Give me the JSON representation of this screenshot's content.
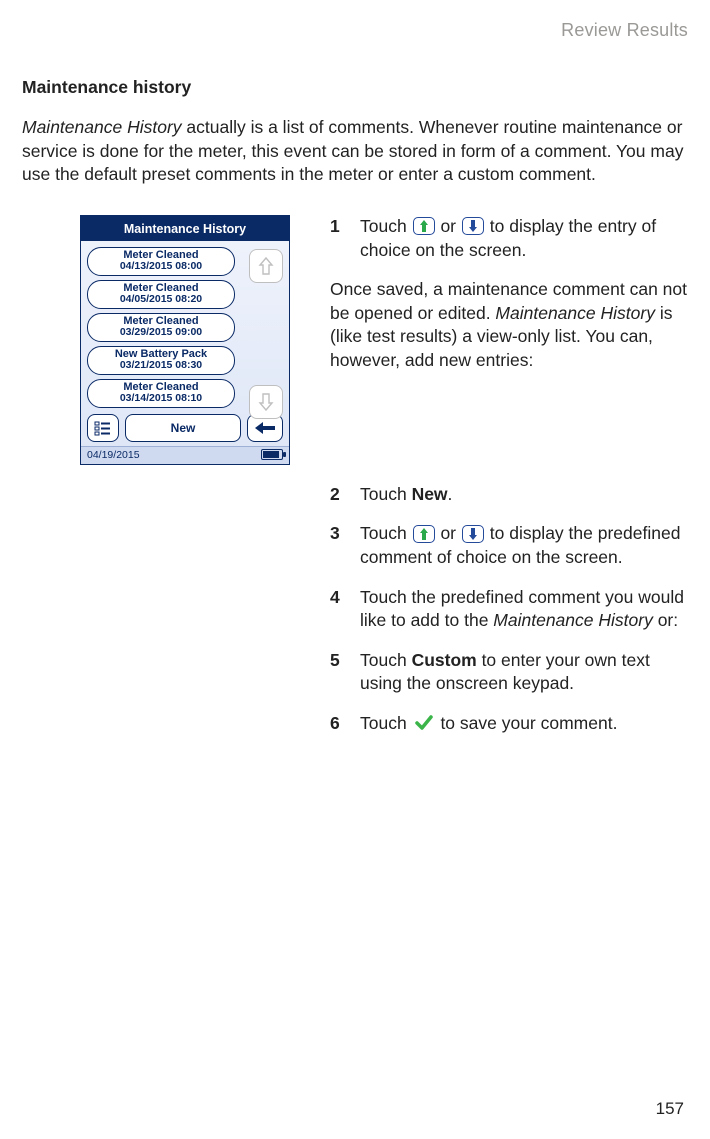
{
  "page": {
    "running_head": "Review Results",
    "section_title": "Maintenance history",
    "intro_em": "Maintenance History",
    "intro_rest": " actually is a list of comments. Whenever routine maintenance or service is done for the meter, this event can be stored in form of a comment. You may use the default preset comments in the meter or enter a custom comment.",
    "page_number": "157"
  },
  "device": {
    "title": "Maintenance History",
    "entries": [
      {
        "label": "Meter Cleaned",
        "stamp": "04/13/2015 08:00"
      },
      {
        "label": "Meter Cleaned",
        "stamp": "04/05/2015 08:20"
      },
      {
        "label": "Meter Cleaned",
        "stamp": "03/29/2015 09:00"
      },
      {
        "label": "New Battery Pack",
        "stamp": "03/21/2015 08:30"
      },
      {
        "label": "Meter Cleaned",
        "stamp": "03/14/2015 08:10"
      }
    ],
    "new_label": "New",
    "status_date": "04/19/2015"
  },
  "steps": {
    "s1_a": "Touch ",
    "s1_b": " or ",
    "s1_c": " to display the entry of choice on the screen.",
    "note_a": "Once saved, a maintenance comment can not be opened or edited. ",
    "note_em": "Maintenance History",
    "note_b": " is (like test results) a view-only list. You can, however, add new entries:",
    "s2_a": "Touch ",
    "s2_bold": "New",
    "s2_b": ".",
    "s3_a": "Touch ",
    "s3_b": " or ",
    "s3_c": " to display the predefined comment of choice on the screen.",
    "s4_a": "Touch the predefined comment you would like to add to the ",
    "s4_em": "Maintenance History",
    "s4_b": " or:",
    "s5_a": "Touch ",
    "s5_bold": "Custom",
    "s5_b": " to enter your own text using the onscreen keypad.",
    "s6_a": "Touch ",
    "s6_b": " to save your comment."
  },
  "nums": {
    "n1": "1",
    "n2": "2",
    "n3": "3",
    "n4": "4",
    "n5": "5",
    "n6": "6"
  }
}
